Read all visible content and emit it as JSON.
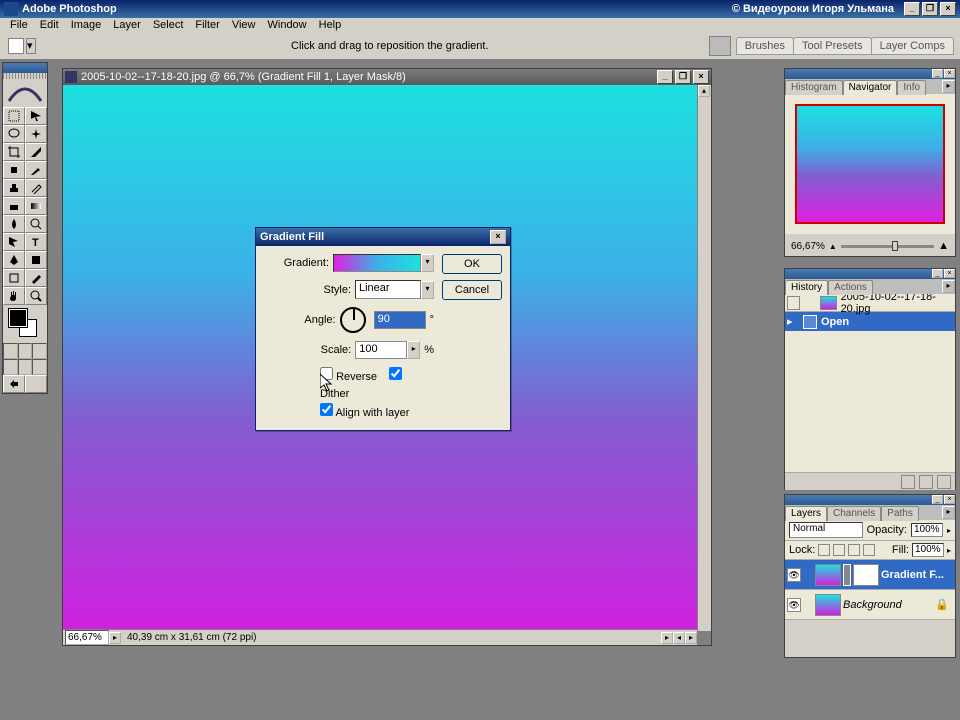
{
  "app": {
    "title": "Adobe Photoshop",
    "watermark": "© Видеоуроки Игоря Ульмана"
  },
  "menu": [
    "File",
    "Edit",
    "Image",
    "Layer",
    "Select",
    "Filter",
    "View",
    "Window",
    "Help"
  ],
  "optionbar": {
    "hint": "Click and drag to reposition the gradient.",
    "tabs": [
      "Brushes",
      "Tool Presets",
      "Layer Comps"
    ]
  },
  "document": {
    "title": "2005-10-02--17-18-20.jpg @ 66,7% (Gradient Fill 1, Layer Mask/8)",
    "zoom": "66,67%",
    "info": "40,39 cm x 31,61 cm (72 ppi)"
  },
  "dialog": {
    "title": "Gradient Fill",
    "labels": {
      "gradient": "Gradient:",
      "style": "Style:",
      "angle": "Angle:",
      "scale": "Scale:"
    },
    "style": "Linear",
    "angle": "90",
    "scale": "100",
    "scale_unit": "%",
    "angle_unit": "°",
    "reverse": "Reverse",
    "dither": "Dither",
    "align": "Align with layer",
    "ok": "OK",
    "cancel": "Cancel"
  },
  "navigator": {
    "tabs": [
      "Histogram",
      "Navigator",
      "Info"
    ],
    "zoom": "66,67%"
  },
  "history": {
    "tabs": [
      "History",
      "Actions"
    ],
    "snapshot": "2005-10-02--17-18-20.jpg",
    "step": "Open"
  },
  "layers": {
    "tabs": [
      "Layers",
      "Channels",
      "Paths"
    ],
    "mode": "Normal",
    "opacity_lab": "Opacity:",
    "opacity": "100%",
    "lock_lab": "Lock:",
    "fill_lab": "Fill:",
    "fill": "100%",
    "rows": [
      {
        "name": "Gradient F..."
      },
      {
        "name": "Background"
      }
    ]
  }
}
